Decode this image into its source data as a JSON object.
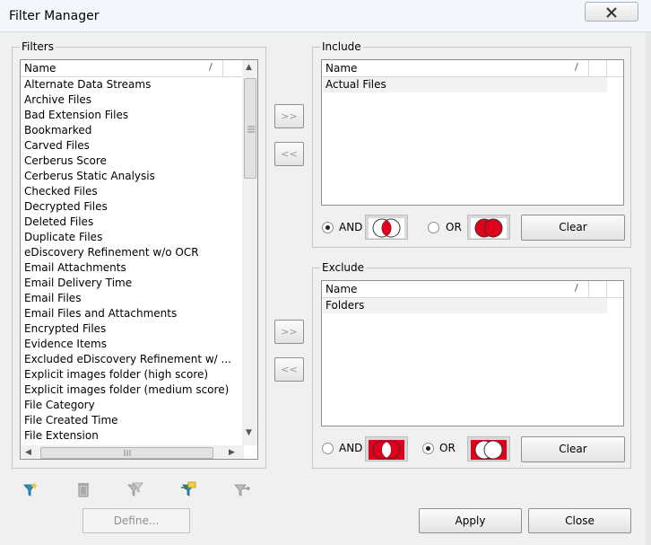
{
  "window": {
    "title": "Filter Manager",
    "close_glyph": "☒"
  },
  "filters": {
    "legend": "Filters",
    "column": "Name",
    "sort_glyph": "/",
    "items": [
      "Alternate Data Streams",
      "Archive Files",
      "Bad Extension Files",
      "Bookmarked",
      "Carved Files",
      "Cerberus Score",
      "Cerberus Static Analysis",
      "Checked Files",
      "Decrypted Files",
      "Deleted Files",
      "Duplicate Files",
      "eDiscovery Refinement w/o OCR",
      "Email Attachments",
      "Email Delivery Time",
      "Email Files",
      "Email Files and Attachments",
      "Encrypted Files",
      "Evidence Items",
      "Excluded eDiscovery Refinement w/ ...",
      "Explicit images folder (high score)",
      "Explicit images folder (medium score)",
      "File Category",
      "File Created Time",
      "File Extension"
    ]
  },
  "include": {
    "legend": "Include",
    "column": "Name",
    "sort_glyph": "/",
    "items": [
      "Actual Files"
    ],
    "and_label": "AND",
    "or_label": "OR",
    "clear_label": "Clear",
    "selected": "AND"
  },
  "exclude": {
    "legend": "Exclude",
    "column": "Name",
    "sort_glyph": "/",
    "items": [
      "Folders"
    ],
    "and_label": "AND",
    "or_label": "OR",
    "clear_label": "Clear",
    "selected": "OR"
  },
  "transfer": {
    "add_label": ">>",
    "remove_label": "<<"
  },
  "toolbar": {
    "icons": [
      "new-filter-icon",
      "delete-filter-icon",
      "copy-filter-icon",
      "import-filter-icon",
      "export-filter-icon"
    ]
  },
  "footer": {
    "define_label": "Define...",
    "apply_label": "Apply",
    "close_label": "Close"
  },
  "colors": {
    "venn_red": "#e0001b",
    "venn_border": "#c00000"
  }
}
